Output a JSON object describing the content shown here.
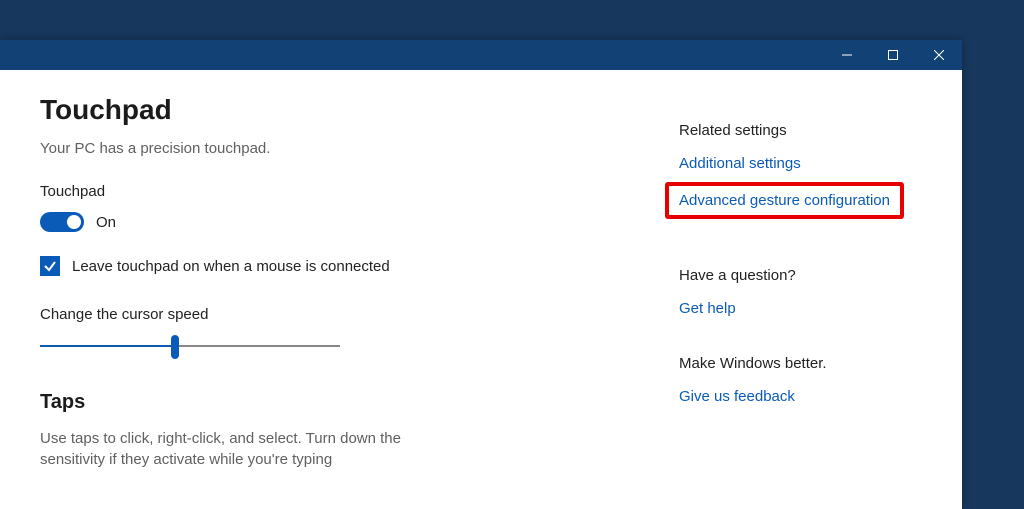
{
  "page": {
    "title": "Touchpad",
    "subtitle": "Your PC has a precision touchpad."
  },
  "touchpad": {
    "label": "Touchpad",
    "state": "On",
    "leave_on_label": "Leave touchpad on when a mouse is connected"
  },
  "cursor": {
    "label": "Change the cursor speed",
    "value": 45
  },
  "taps": {
    "heading": "Taps",
    "desc": "Use taps to click, right-click, and select. Turn down the sensitivity if they activate while you're typing"
  },
  "sidebar": {
    "related_heading": "Related settings",
    "additional_link": "Additional settings",
    "advanced_link": "Advanced gesture configuration",
    "question_heading": "Have a question?",
    "help_link": "Get help",
    "better_heading": "Make Windows better.",
    "feedback_link": "Give us feedback"
  }
}
